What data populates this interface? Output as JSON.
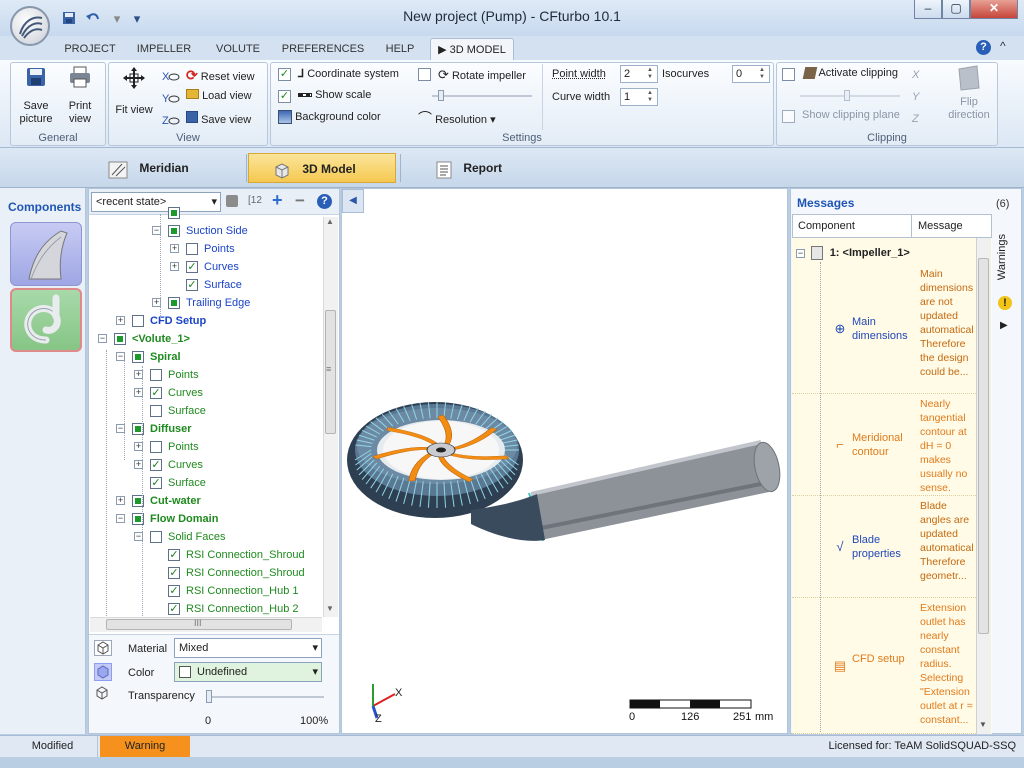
{
  "window": {
    "title": "New project (Pump) - CFturbo 10.1",
    "minimize_glyph": "–",
    "maximize_glyph": "▢",
    "close_glyph": "✕",
    "quick_access": {
      "save_icon": "save-icon",
      "undo_icon": "undo-icon",
      "customize_glyph": "▾"
    }
  },
  "tabs": [
    {
      "label": "PROJECT"
    },
    {
      "label": "IMPELLER"
    },
    {
      "label": "VOLUTE"
    },
    {
      "label": "PREFERENCES"
    },
    {
      "label": "HELP"
    },
    {
      "label": "3D MODEL",
      "glyph": "▶",
      "active": true
    }
  ],
  "ribbon": {
    "help_glyph": "?",
    "collapse_glyph": "^",
    "general": {
      "label": "General",
      "save_picture": "Save\npicture",
      "print_view": "Print\nview"
    },
    "view": {
      "label": "View",
      "fit_view": "Fit view",
      "reset_view": "Reset view",
      "load_view": "Load view",
      "save_view": "Save view",
      "axis_x": "X",
      "axis_y": "Y",
      "axis_z": "Z"
    },
    "settings": {
      "label": "Settings",
      "coordinate_system": "Coordinate system",
      "coordinate_system_checked": true,
      "show_scale": "Show scale",
      "show_scale_checked": true,
      "background_color": "Background color",
      "rotate_impeller": "Rotate impeller",
      "rotate_impeller_checked": false,
      "resolution": "Resolution",
      "resolution_glyph": "▾",
      "point_width": "Point width",
      "point_width_value": "2",
      "curve_width": "Curve width",
      "curve_width_value": "1",
      "isocurves": "Isocurves",
      "isocurves_value": "0"
    },
    "clipping": {
      "label": "Clipping",
      "activate_clipping": "Activate clipping",
      "show_clipping_plane": "Show clipping plane",
      "flip_direction": "Flip\ndirection"
    }
  },
  "view_modes": [
    {
      "label": "Meridian"
    },
    {
      "label": "3D Model",
      "active": true
    },
    {
      "label": "Report"
    }
  ],
  "components_panel": {
    "title": "Components"
  },
  "tree_panel": {
    "state_select": "<recent state>",
    "state_select_glyph": "▾",
    "toolbar_glyphs": {
      "info_glyph": "[12",
      "add": "+",
      "remove": "−",
      "help": "?"
    },
    "nodes": [
      {
        "label": "",
        "depth": 4,
        "expander": false,
        "checked": "filled"
      },
      {
        "label": "Suction Side",
        "depth": 4,
        "expander": "−",
        "checked": "filled",
        "style": "blue"
      },
      {
        "label": "Points",
        "depth": 5,
        "expander": "+",
        "checked": "none",
        "style": "blue"
      },
      {
        "label": "Curves",
        "depth": 5,
        "expander": "+",
        "checked": "check",
        "style": "blue"
      },
      {
        "label": "Surface",
        "depth": 5,
        "expander": false,
        "checked": "check",
        "style": "blue"
      },
      {
        "label": "Trailing Edge",
        "depth": 4,
        "expander": "+",
        "checked": "filled",
        "style": "blue"
      },
      {
        "label": "CFD Setup",
        "depth": 2,
        "expander": "+",
        "checked": "none",
        "style": "blue bold"
      },
      {
        "label": "<Volute_1>",
        "depth": 1,
        "expander": "−",
        "checked": "filled",
        "style": "green bold"
      },
      {
        "label": "Spiral",
        "depth": 2,
        "expander": "−",
        "checked": "filled",
        "style": "green bold"
      },
      {
        "label": "Points",
        "depth": 3,
        "expander": "+",
        "checked": "none",
        "style": "green"
      },
      {
        "label": "Curves",
        "depth": 3,
        "expander": "+",
        "checked": "check",
        "style": "green"
      },
      {
        "label": "Surface",
        "depth": 3,
        "expander": false,
        "checked": "none",
        "style": "green"
      },
      {
        "label": "Diffuser",
        "depth": 2,
        "expander": "−",
        "checked": "filled",
        "style": "green bold"
      },
      {
        "label": "Points",
        "depth": 3,
        "expander": "+",
        "checked": "none",
        "style": "green"
      },
      {
        "label": "Curves",
        "depth": 3,
        "expander": "+",
        "checked": "check",
        "style": "green"
      },
      {
        "label": "Surface",
        "depth": 3,
        "expander": false,
        "checked": "check",
        "style": "green"
      },
      {
        "label": "Cut-water",
        "depth": 2,
        "expander": "+",
        "checked": "filled",
        "style": "green bold"
      },
      {
        "label": "Flow Domain",
        "depth": 2,
        "expander": "−",
        "checked": "filled",
        "style": "green bold"
      },
      {
        "label": "Solid Faces",
        "depth": 3,
        "expander": "−",
        "checked": "none",
        "style": "green"
      },
      {
        "label": "RSI Connection_Shroud",
        "depth": 4,
        "expander": false,
        "checked": "check",
        "style": "green"
      },
      {
        "label": "RSI Connection_Shroud",
        "depth": 4,
        "expander": false,
        "checked": "check",
        "style": "green"
      },
      {
        "label": "RSI Connection_Hub 1",
        "depth": 4,
        "expander": false,
        "checked": "check",
        "style": "green"
      },
      {
        "label": "RSI Connection_Hub 2",
        "depth": 4,
        "expander": false,
        "checked": "check",
        "style": "green"
      }
    ],
    "scroll_glyph_up": "▲",
    "scroll_glyph_down": "▼",
    "hscroll_grip": "III",
    "vscroll_grip": "≡"
  },
  "properties": {
    "material_label": "Material",
    "material_value": "Mixed",
    "color_label": "Color",
    "color_value": "Undefined",
    "transparency_label": "Transparency",
    "transparency_min": "0",
    "transparency_max": "100%",
    "transparency_value": 0,
    "dropdown_glyph": "▾"
  },
  "viewport": {
    "collapse_glyph": "◀",
    "axis_x": "X",
    "axis_z": "Z",
    "scale_ticks": [
      "0",
      "126",
      "251"
    ],
    "scale_unit": "mm",
    "colors": {
      "volute": "#6d8aa5",
      "impeller": "#f28c12",
      "pipe": "#8d9299",
      "grid": "#8fd7e6"
    }
  },
  "messages": {
    "title": "Messages",
    "count": "(6)",
    "col_component": "Component",
    "col_message": "Message",
    "group_label": "1: <Impeller_1>",
    "items": [
      {
        "component": "Main\ndimensions",
        "text": "Main dimensions are not updated automatically. Therefore the design could be...",
        "icon": "diameter-icon",
        "color": "#2148b8",
        "text_color": "#c46a12"
      },
      {
        "component": "Meridional\ncontour",
        "text": "Nearly tangential contour at dH = 0 makes usually no sense.",
        "icon": "meridian-contour-icon",
        "color": "#e07b1d",
        "text_color": "#e07b1d"
      },
      {
        "component": "Blade\nproperties",
        "text": "Blade angles are updated automatically. Therefore geometr...",
        "icon": "blade-angle-icon",
        "color": "#2148b8",
        "text_color": "#c46a12"
      },
      {
        "component": "CFD setup",
        "text": "Extension outlet has nearly constant radius. Selecting \"Extension outlet at r = constant...",
        "icon": "cfd-setup-icon",
        "color": "#e07b1d",
        "text_color": "#e07b1d"
      }
    ],
    "warnings_label": "Warnings",
    "warning_icon": "warning-icon",
    "expand_glyph": "▶"
  },
  "statusbar": {
    "modified": "Modified",
    "warning": "Warning",
    "license": "Licensed for: TeAM SolidSQUAD-SSQ"
  }
}
